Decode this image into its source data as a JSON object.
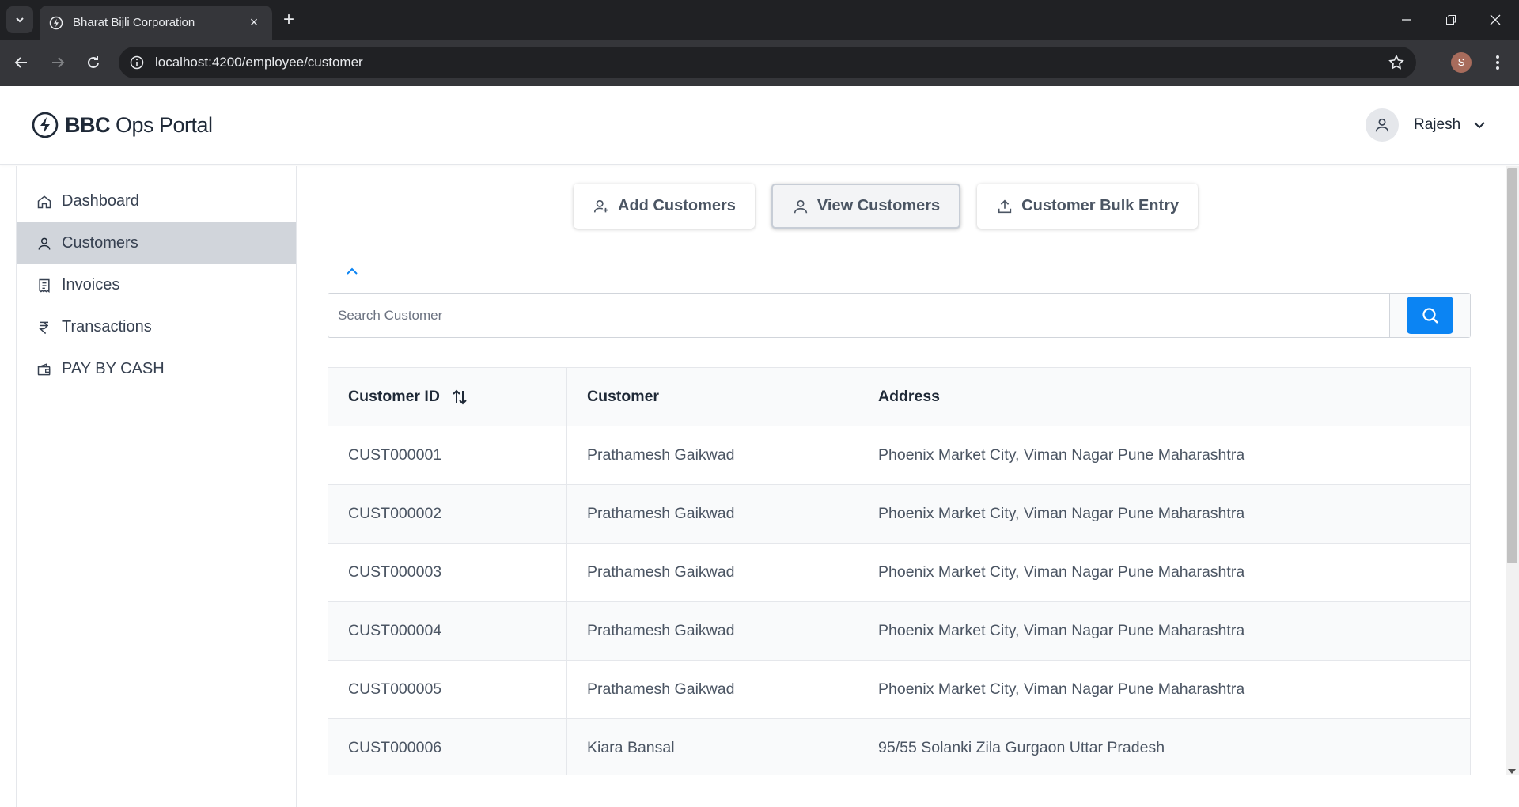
{
  "browser": {
    "tab_title": "Bharat Bijli Corporation",
    "url": "localhost:4200/employee/customer",
    "profile_initial": "S"
  },
  "header": {
    "logo_bold": "BBC",
    "logo_rest": " Ops Portal",
    "user_name": "Rajesh"
  },
  "sidebar": {
    "items": [
      {
        "label": "Dashboard",
        "icon": "home-icon"
      },
      {
        "label": "Customers",
        "icon": "user-icon",
        "active": true
      },
      {
        "label": "Invoices",
        "icon": "receipt-icon"
      },
      {
        "label": "Transactions",
        "icon": "rupee-icon"
      },
      {
        "label": "PAY BY CASH",
        "icon": "wallet-icon"
      }
    ]
  },
  "actions": {
    "add_label": "Add Customers",
    "view_label": "View Customers",
    "bulk_label": "Customer Bulk Entry"
  },
  "search": {
    "placeholder": "Search Customer"
  },
  "table": {
    "headers": [
      "Customer ID",
      "Customer",
      "Address"
    ],
    "rows": [
      [
        "CUST000001",
        "Prathamesh Gaikwad",
        "Phoenix Market City, Viman Nagar Pune Maharashtra"
      ],
      [
        "CUST000002",
        "Prathamesh Gaikwad",
        "Phoenix Market City, Viman Nagar Pune Maharashtra"
      ],
      [
        "CUST000003",
        "Prathamesh Gaikwad",
        "Phoenix Market City, Viman Nagar Pune Maharashtra"
      ],
      [
        "CUST000004",
        "Prathamesh Gaikwad",
        "Phoenix Market City, Viman Nagar Pune Maharashtra"
      ],
      [
        "CUST000005",
        "Prathamesh Gaikwad",
        "Phoenix Market City, Viman Nagar Pune Maharashtra"
      ],
      [
        "CUST000006",
        "Kiara Bansal",
        "95/55 Solanki Zila Gurgaon Uttar Pradesh"
      ]
    ]
  },
  "colors": {
    "accent": "#0b84f3",
    "active_nav": "#d1d5db"
  }
}
